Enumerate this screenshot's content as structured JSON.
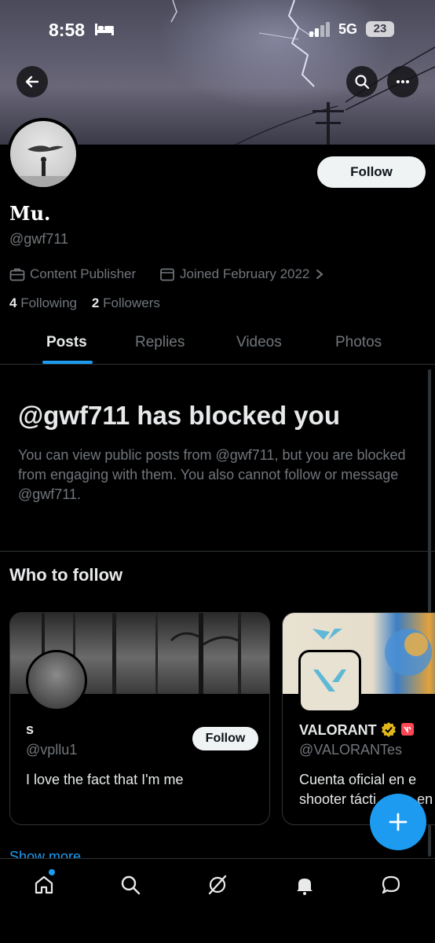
{
  "status_bar": {
    "time": "8:58",
    "network": "5G",
    "battery": "23"
  },
  "profile": {
    "name": "Mu.",
    "handle": "@gwf711",
    "category": "Content Publisher",
    "joined": "Joined February 2022",
    "following_count": "4",
    "following_label": "Following",
    "followers_count": "2",
    "followers_label": "Followers",
    "follow_label": "Follow"
  },
  "tabs": [
    {
      "label": "Posts",
      "active": true
    },
    {
      "label": "Replies",
      "active": false
    },
    {
      "label": "Videos",
      "active": false
    },
    {
      "label": "Photos",
      "active": false
    }
  ],
  "blocked": {
    "title": "@gwf711 has blocked you",
    "description": "You can view public posts from @gwf711, but you are blocked from engaging with them. You also cannot follow or message @gwf711."
  },
  "who_to_follow": {
    "title": "Who to follow",
    "cards": [
      {
        "name": "s",
        "handle": "@vpllu1",
        "bio": "I love the fact that I'm me",
        "follow_label": "Follow"
      },
      {
        "name": "VALORANT",
        "handle": "@VALORANTes",
        "bio_line1": "Cuenta oficial en e",
        "bio_line2": "shooter tácti",
        "bio_line2_end": "en"
      }
    ],
    "show_more": "Show more"
  },
  "colors": {
    "accent": "#1d9bf0",
    "background": "#000000",
    "muted": "#71767b",
    "text": "#e7e9ea"
  },
  "icons": {
    "back": "arrow-left-icon",
    "search": "search-icon",
    "more": "more-horizontal-icon",
    "briefcase": "briefcase-icon",
    "calendar": "calendar-icon",
    "nav": [
      "home-icon",
      "search-icon",
      "grok-icon",
      "bell-icon",
      "message-icon"
    ],
    "fab": "plus-icon"
  }
}
